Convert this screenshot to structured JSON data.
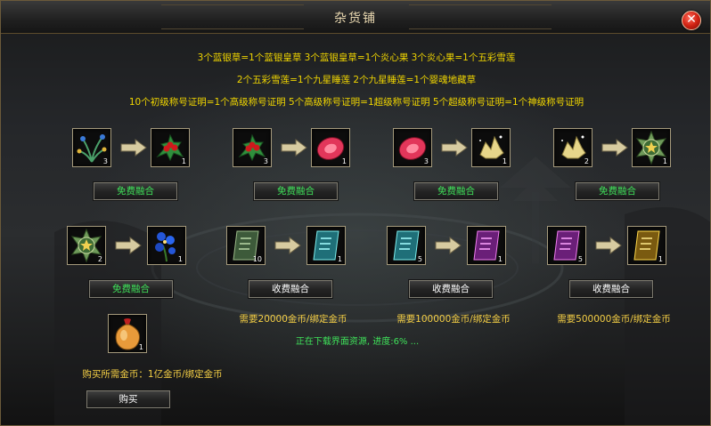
{
  "window": {
    "title": "杂货铺",
    "close_icon": "close-icon"
  },
  "recipes": [
    "3个蓝银草=1个蓝银皇草   3个蓝银皇草=1个炎心果   3个炎心果=1个五彩雪莲",
    "2个五彩雪莲=1个九星睡莲   2个九星睡莲=1个婴魂地藏草",
    "10个初级称号证明=1个高级称号证明   5个高级称号证明=1超级称号证明   5个超级称号证明=1个神级称号证明"
  ],
  "fusion_row1": [
    {
      "input": {
        "icon": "blue-silver-grass-icon",
        "qty": "3"
      },
      "output": {
        "icon": "holly-berry-icon",
        "qty": "1"
      },
      "button": "免费融合"
    },
    {
      "input": {
        "icon": "holly-berry-icon",
        "qty": "3"
      },
      "output": {
        "icon": "red-gem-fruit-icon",
        "qty": "1"
      },
      "button": "免费融合"
    },
    {
      "input": {
        "icon": "red-gem-fruit-icon",
        "qty": "3"
      },
      "output": {
        "icon": "golden-lotus-icon",
        "qty": "1"
      },
      "button": "免费融合"
    },
    {
      "input": {
        "icon": "golden-lotus-icon",
        "qty": "2"
      },
      "output": {
        "icon": "star-medal-icon",
        "qty": "1"
      },
      "button": "免费融合"
    }
  ],
  "fusion_row2": [
    {
      "input": {
        "icon": "star-medal-icon",
        "qty": "2"
      },
      "output": {
        "icon": "blue-flower-icon",
        "qty": "1"
      },
      "button": "免费融合",
      "cost": ""
    },
    {
      "input": {
        "icon": "green-title-card-icon",
        "qty": "10"
      },
      "output": {
        "icon": "cyan-title-card-icon",
        "qty": "1"
      },
      "button": "收费融合",
      "cost": "需要20000金币/绑定金币"
    },
    {
      "input": {
        "icon": "cyan-title-card-icon",
        "qty": "5"
      },
      "output": {
        "icon": "purple-title-card-icon",
        "qty": "1"
      },
      "button": "收费融合",
      "cost": "需要100000金币/绑定金币"
    },
    {
      "input": {
        "icon": "purple-title-card-icon",
        "qty": "5"
      },
      "output": {
        "icon": "gold-title-card-icon",
        "qty": "1"
      },
      "button": "收费融合",
      "cost": "需要500000金币/绑定金币"
    }
  ],
  "status": "正在下载界面资源, 进度:6% ...",
  "purchase": {
    "item": {
      "icon": "gold-pouch-icon",
      "qty": "1"
    },
    "cost_label": "购买所需金币：1亿金币/绑定金币",
    "button": "购买"
  },
  "colors": {
    "free_button_text": "#3fe25a",
    "recipe_text": "#f0d500",
    "cost_text": "#f5cf45"
  },
  "arrow_icon": "right-arrow-icon"
}
